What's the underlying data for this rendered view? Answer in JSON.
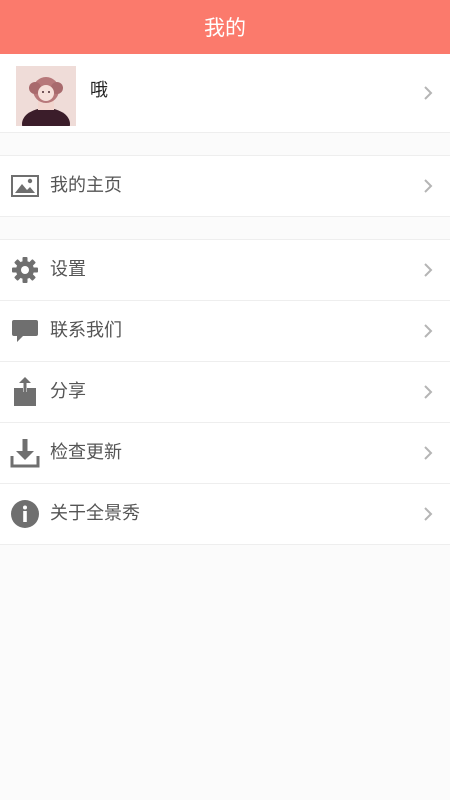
{
  "header": {
    "title": "我的"
  },
  "profile": {
    "name": "哦",
    "icon": "avatar-girl"
  },
  "menu": [
    {
      "label": "我的主页",
      "icon": "image-icon"
    },
    {
      "label": "设置",
      "icon": "gear-icon"
    },
    {
      "label": "联系我们",
      "icon": "chat-bubble-icon"
    },
    {
      "label": "分享",
      "icon": "share-icon"
    },
    {
      "label": "检查更新",
      "icon": "download-icon"
    },
    {
      "label": "关于全景秀",
      "icon": "info-icon"
    }
  ],
  "colors": {
    "header_bg": "#fb7a6c",
    "icon_gray": "#6f6f6f",
    "chevron_gray": "#b5b5b5"
  }
}
